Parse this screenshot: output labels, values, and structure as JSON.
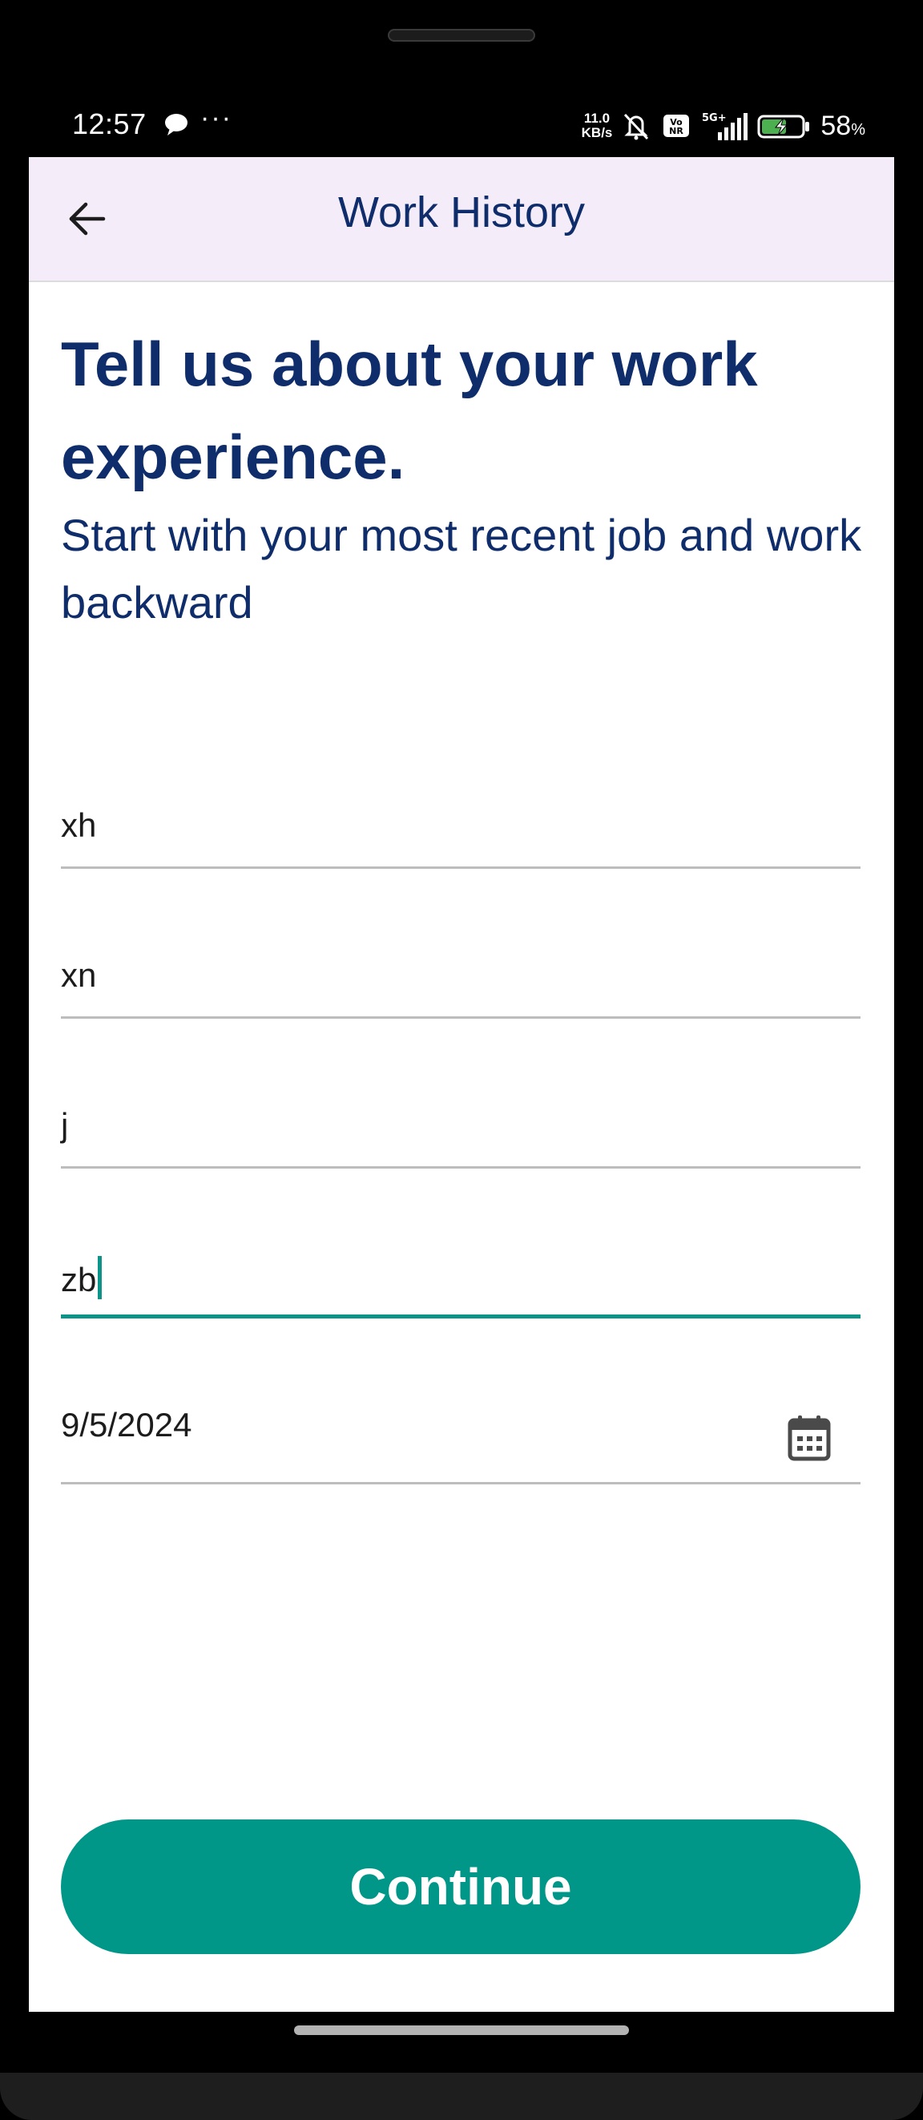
{
  "status_bar": {
    "time": "12:57",
    "more_indicator": "···",
    "net_speed_value": "11.0",
    "net_speed_unit": "KB/s",
    "network_type": "5G+",
    "volte_badge": "Vo NR",
    "battery_percent": "58",
    "battery_percent_sign": "%",
    "icons": [
      "message-icon",
      "mute-icon",
      "volte-icon",
      "signal-icon",
      "battery-charging-icon"
    ]
  },
  "app_bar": {
    "title": "Work History",
    "back_icon": "arrow-back-icon"
  },
  "content": {
    "headline": "Tell us about your work experience.",
    "subheadline": "Start with your most recent job and work backward"
  },
  "form": {
    "fields": [
      {
        "value": "xh"
      },
      {
        "value": "xn"
      },
      {
        "value": "j"
      },
      {
        "value": "zb",
        "focused": true
      },
      {
        "value": "9/5/2024",
        "icon": "calendar-icon"
      }
    ]
  },
  "actions": {
    "continue_label": "Continue"
  },
  "colors": {
    "primary_text": "#0f2d6b",
    "accent": "#009688",
    "app_bar_bg": "#f4edf9",
    "divider": "#bdbdbd"
  }
}
